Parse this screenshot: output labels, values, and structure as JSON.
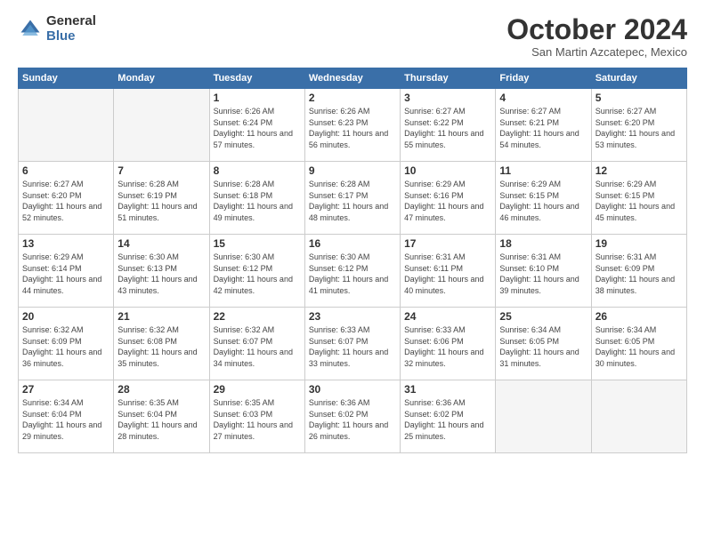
{
  "logo": {
    "general": "General",
    "blue": "Blue"
  },
  "title": "October 2024",
  "subtitle": "San Martin Azcatepec, Mexico",
  "days_of_week": [
    "Sunday",
    "Monday",
    "Tuesday",
    "Wednesday",
    "Thursday",
    "Friday",
    "Saturday"
  ],
  "weeks": [
    [
      {
        "day": "",
        "empty": true
      },
      {
        "day": "",
        "empty": true
      },
      {
        "day": "1",
        "sunrise": "6:26 AM",
        "sunset": "6:24 PM",
        "daylight": "11 hours and 57 minutes."
      },
      {
        "day": "2",
        "sunrise": "6:26 AM",
        "sunset": "6:23 PM",
        "daylight": "11 hours and 56 minutes."
      },
      {
        "day": "3",
        "sunrise": "6:27 AM",
        "sunset": "6:22 PM",
        "daylight": "11 hours and 55 minutes."
      },
      {
        "day": "4",
        "sunrise": "6:27 AM",
        "sunset": "6:21 PM",
        "daylight": "11 hours and 54 minutes."
      },
      {
        "day": "5",
        "sunrise": "6:27 AM",
        "sunset": "6:20 PM",
        "daylight": "11 hours and 53 minutes."
      }
    ],
    [
      {
        "day": "6",
        "sunrise": "6:27 AM",
        "sunset": "6:20 PM",
        "daylight": "11 hours and 52 minutes."
      },
      {
        "day": "7",
        "sunrise": "6:28 AM",
        "sunset": "6:19 PM",
        "daylight": "11 hours and 51 minutes."
      },
      {
        "day": "8",
        "sunrise": "6:28 AM",
        "sunset": "6:18 PM",
        "daylight": "11 hours and 49 minutes."
      },
      {
        "day": "9",
        "sunrise": "6:28 AM",
        "sunset": "6:17 PM",
        "daylight": "11 hours and 48 minutes."
      },
      {
        "day": "10",
        "sunrise": "6:29 AM",
        "sunset": "6:16 PM",
        "daylight": "11 hours and 47 minutes."
      },
      {
        "day": "11",
        "sunrise": "6:29 AM",
        "sunset": "6:15 PM",
        "daylight": "11 hours and 46 minutes."
      },
      {
        "day": "12",
        "sunrise": "6:29 AM",
        "sunset": "6:15 PM",
        "daylight": "11 hours and 45 minutes."
      }
    ],
    [
      {
        "day": "13",
        "sunrise": "6:29 AM",
        "sunset": "6:14 PM",
        "daylight": "11 hours and 44 minutes."
      },
      {
        "day": "14",
        "sunrise": "6:30 AM",
        "sunset": "6:13 PM",
        "daylight": "11 hours and 43 minutes."
      },
      {
        "day": "15",
        "sunrise": "6:30 AM",
        "sunset": "6:12 PM",
        "daylight": "11 hours and 42 minutes."
      },
      {
        "day": "16",
        "sunrise": "6:30 AM",
        "sunset": "6:12 PM",
        "daylight": "11 hours and 41 minutes."
      },
      {
        "day": "17",
        "sunrise": "6:31 AM",
        "sunset": "6:11 PM",
        "daylight": "11 hours and 40 minutes."
      },
      {
        "day": "18",
        "sunrise": "6:31 AM",
        "sunset": "6:10 PM",
        "daylight": "11 hours and 39 minutes."
      },
      {
        "day": "19",
        "sunrise": "6:31 AM",
        "sunset": "6:09 PM",
        "daylight": "11 hours and 38 minutes."
      }
    ],
    [
      {
        "day": "20",
        "sunrise": "6:32 AM",
        "sunset": "6:09 PM",
        "daylight": "11 hours and 36 minutes."
      },
      {
        "day": "21",
        "sunrise": "6:32 AM",
        "sunset": "6:08 PM",
        "daylight": "11 hours and 35 minutes."
      },
      {
        "day": "22",
        "sunrise": "6:32 AM",
        "sunset": "6:07 PM",
        "daylight": "11 hours and 34 minutes."
      },
      {
        "day": "23",
        "sunrise": "6:33 AM",
        "sunset": "6:07 PM",
        "daylight": "11 hours and 33 minutes."
      },
      {
        "day": "24",
        "sunrise": "6:33 AM",
        "sunset": "6:06 PM",
        "daylight": "11 hours and 32 minutes."
      },
      {
        "day": "25",
        "sunrise": "6:34 AM",
        "sunset": "6:05 PM",
        "daylight": "11 hours and 31 minutes."
      },
      {
        "day": "26",
        "sunrise": "6:34 AM",
        "sunset": "6:05 PM",
        "daylight": "11 hours and 30 minutes."
      }
    ],
    [
      {
        "day": "27",
        "sunrise": "6:34 AM",
        "sunset": "6:04 PM",
        "daylight": "11 hours and 29 minutes."
      },
      {
        "day": "28",
        "sunrise": "6:35 AM",
        "sunset": "6:04 PM",
        "daylight": "11 hours and 28 minutes."
      },
      {
        "day": "29",
        "sunrise": "6:35 AM",
        "sunset": "6:03 PM",
        "daylight": "11 hours and 27 minutes."
      },
      {
        "day": "30",
        "sunrise": "6:36 AM",
        "sunset": "6:02 PM",
        "daylight": "11 hours and 26 minutes."
      },
      {
        "day": "31",
        "sunrise": "6:36 AM",
        "sunset": "6:02 PM",
        "daylight": "11 hours and 25 minutes."
      },
      {
        "day": "",
        "empty": true
      },
      {
        "day": "",
        "empty": true
      }
    ]
  ],
  "labels": {
    "sunrise": "Sunrise:",
    "sunset": "Sunset:",
    "daylight": "Daylight:"
  }
}
